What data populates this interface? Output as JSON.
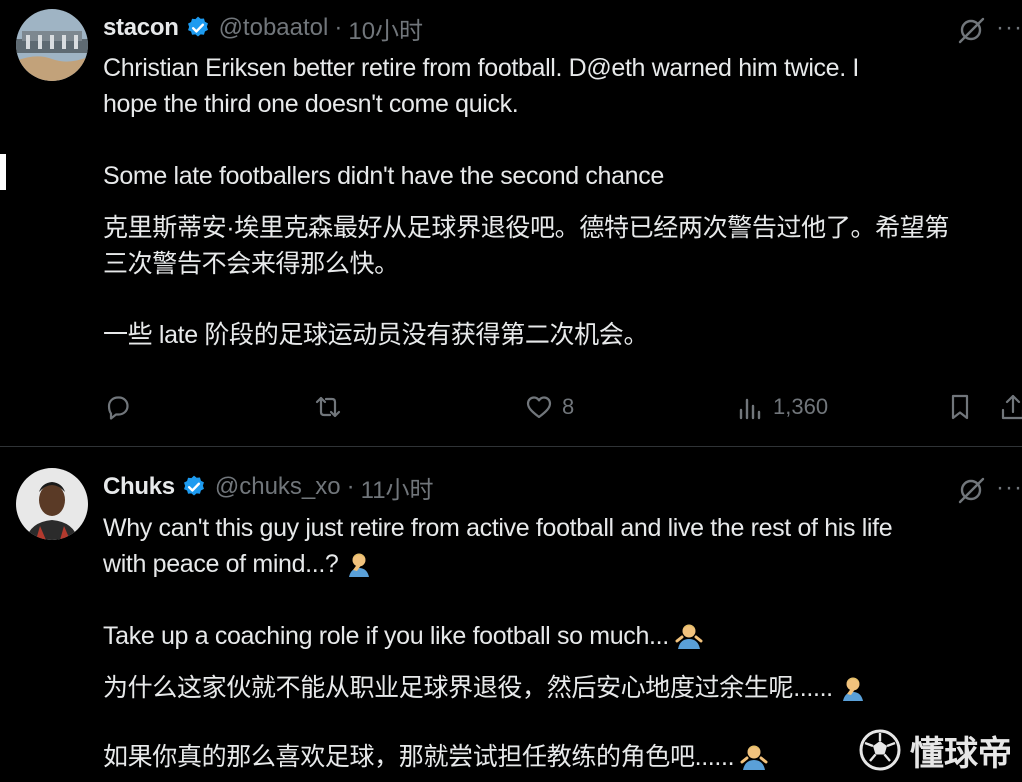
{
  "posts": [
    {
      "display_name": "stacon",
      "handle": "@tobaatol",
      "separator": "·",
      "time": "10小时",
      "paragraphs": [
        "Christian Eriksen  better retire from football. D@eth warned him twice. I",
        "hope the third one doesn't come quick.",
        "Some late footballers didn't have the second chance",
        "克里斯蒂安·埃里克森最好从足球界退役吧。德特已经两次警告过他了。希望第",
        "三次警告不会来得那么快。",
        "一些 late 阶段的足球运动员没有获得第二次机会。"
      ],
      "actions": {
        "reply_count": "",
        "repost_count": "",
        "like_count": "8",
        "view_count": "1,360"
      }
    },
    {
      "display_name": "Chuks",
      "handle": "@chuks_xo",
      "separator": "·",
      "time": "11小时",
      "paragraphs": [
        "Why can't this guy just retire from active football and live the rest of his life",
        "with peace of mind...?",
        "Take up a coaching role if you like football so much...",
        "为什么这家伙就不能从职业足球界退役，然后安心地度过余生呢......",
        "如果你真的那么喜欢足球，那就尝试担任教练的角色吧......"
      ]
    }
  ],
  "icons": {
    "verified": "verified-badge-icon",
    "grok": "grok-icon",
    "more": "more-icon",
    "reply": "reply-icon",
    "repost": "repost-icon",
    "like": "like-icon",
    "views": "views-icon",
    "bookmark": "bookmark-icon",
    "share": "share-icon",
    "facepalm_emoji": "facepalm-emoji-icon",
    "shrug_emoji": "person-emoji-icon"
  },
  "colors": {
    "background": "#000000",
    "text": "#e7e9ea",
    "secondary": "#71767b",
    "verified": "#1d9bf0",
    "divider": "#2f3336"
  },
  "watermark": {
    "text": "懂球帝"
  }
}
